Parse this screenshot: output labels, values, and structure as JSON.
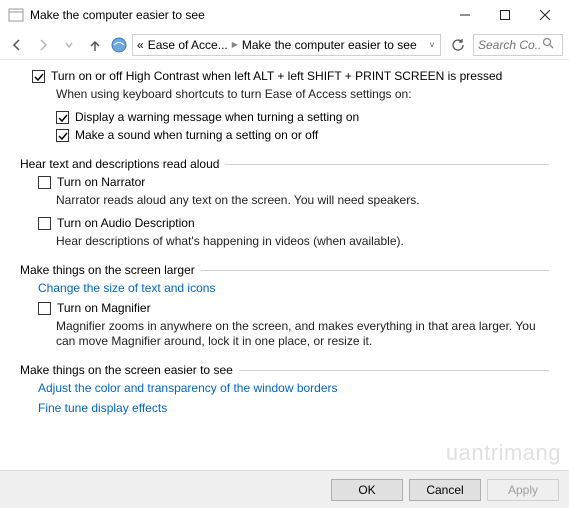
{
  "window": {
    "title": "Make the computer easier to see"
  },
  "breadcrumb": {
    "prefix": "«",
    "seg1": "Ease of Acce...",
    "seg2": "Make the computer easier to see"
  },
  "search": {
    "placeholder": "Search Co..."
  },
  "options": {
    "highContrast": {
      "label": "Turn on or off High Contrast when left ALT + left SHIFT + PRINT SCREEN is pressed",
      "help": "When using keyboard shortcuts to turn Ease of Access settings on:",
      "warning": "Display a warning message when turning a setting on",
      "sound": "Make a sound when turning a setting on or off"
    }
  },
  "sections": {
    "readAloud": {
      "title": "Hear text and descriptions read aloud",
      "narrator": {
        "label": "Turn on Narrator",
        "desc": "Narrator reads aloud any text on the screen. You will need speakers."
      },
      "audioDesc": {
        "label": "Turn on Audio Description",
        "desc": "Hear descriptions of what's happening in videos (when available)."
      }
    },
    "larger": {
      "title": "Make things on the screen larger",
      "link": "Change the size of text and icons",
      "magnifier": {
        "label": "Turn on Magnifier",
        "desc": "Magnifier zooms in anywhere on the screen, and makes everything in that area larger. You can move Magnifier around, lock it in one place, or resize it."
      }
    },
    "easier": {
      "title": "Make things on the screen easier to see",
      "link1": "Adjust the color and transparency of the window borders",
      "link2": "Fine tune display effects"
    }
  },
  "footer": {
    "ok": "OK",
    "cancel": "Cancel",
    "apply": "Apply"
  },
  "watermark": "uantrimang"
}
